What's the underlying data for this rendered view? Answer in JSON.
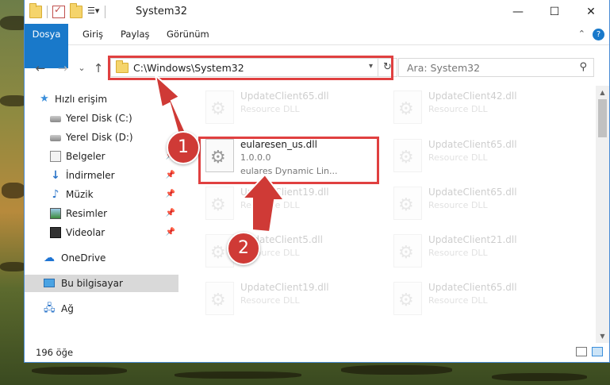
{
  "window": {
    "title": "System32",
    "controls": {
      "minimize": "—",
      "maximize": "☐",
      "close": "✕"
    }
  },
  "ribbon": {
    "tabs": [
      "Dosya",
      "Giriş",
      "Paylaş",
      "Görünüm"
    ],
    "help": "?"
  },
  "navigation": {
    "back": "←",
    "forward": "→",
    "recent": "⌄",
    "up": "↑",
    "address": "C:\\Windows\\System32",
    "search_placeholder": "Ara: System32"
  },
  "sidebar": {
    "items": [
      {
        "label": "Hızlı erişim",
        "icon": "star-icon"
      },
      {
        "label": "Yerel Disk (C:)",
        "icon": "drive-icon"
      },
      {
        "label": "Yerel Disk (D:)",
        "icon": "drive-icon"
      },
      {
        "label": "Belgeler",
        "icon": "documents-icon",
        "pinned": true
      },
      {
        "label": "İndirmeler",
        "icon": "download-icon",
        "pinned": true
      },
      {
        "label": "Müzik",
        "icon": "music-icon",
        "pinned": true
      },
      {
        "label": "Resimler",
        "icon": "pictures-icon",
        "pinned": true
      },
      {
        "label": "Videolar",
        "icon": "video-icon",
        "pinned": true
      },
      {
        "label": "OneDrive",
        "icon": "cloud-icon"
      },
      {
        "label": "Bu bilgisayar",
        "icon": "computer-icon",
        "selected": true
      },
      {
        "label": "Ağ",
        "icon": "network-icon"
      }
    ]
  },
  "files": [
    {
      "name": "UpdateClient65.dll",
      "type": "Resource DLL",
      "faded": true
    },
    {
      "name": "UpdateClient42.dll",
      "type": "Resource DLL",
      "faded": true
    },
    {
      "name": "eularesen_us.dll",
      "version": "1.0.0.0",
      "description": "eulares Dynamic Lin...",
      "faded": false
    },
    {
      "name": "UpdateClient65.dll",
      "type": "Resource DLL",
      "faded": true
    },
    {
      "name": "UpdateClient19.dll",
      "type": "Resource DLL",
      "faded": true
    },
    {
      "name": "UpdateClient65.dll",
      "type": "Resource DLL",
      "faded": true
    },
    {
      "name": "UpdateClient5.dll",
      "type": "Resource DLL",
      "faded": true
    },
    {
      "name": "UpdateClient21.dll",
      "type": "Resource DLL",
      "faded": true
    },
    {
      "name": "UpdateClient19.dll",
      "type": "Resource DLL",
      "faded": true
    },
    {
      "name": "UpdateClient65.dll",
      "type": "Resource DLL",
      "faded": true
    }
  ],
  "status": {
    "item_count": "196 öğe"
  },
  "annotations": {
    "step1": "1",
    "step2": "2"
  },
  "colors": {
    "accent": "#1979ca",
    "highlight_red": "#e04040",
    "badge_red": "#cf3a36"
  }
}
